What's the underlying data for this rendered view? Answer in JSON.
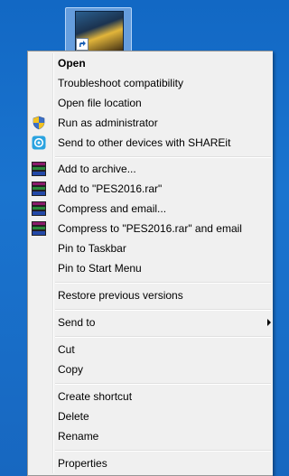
{
  "desktop": {
    "icon": {
      "name": "shortcut-icon",
      "thumbnail": "pes2016-game-cover"
    }
  },
  "context_menu": {
    "items": [
      {
        "label": "Open",
        "bold": true,
        "icon": null
      },
      {
        "label": "Troubleshoot compatibility",
        "icon": null
      },
      {
        "label": "Open file location",
        "icon": null
      },
      {
        "label": "Run as administrator",
        "icon": "uac-shield-icon"
      },
      {
        "label": "Send to other devices with SHAREit",
        "icon": "shareit-icon"
      },
      {
        "label": "Add to archive...",
        "icon": "winrar-icon"
      },
      {
        "label": "Add to \"PES2016.rar\"",
        "icon": "winrar-icon"
      },
      {
        "label": "Compress and email...",
        "icon": "winrar-icon"
      },
      {
        "label": "Compress to \"PES2016.rar\" and email",
        "icon": "winrar-icon"
      },
      {
        "label": "Pin to Taskbar",
        "icon": null
      },
      {
        "label": "Pin to Start Menu",
        "icon": null
      },
      {
        "label": "Restore previous versions",
        "icon": null
      },
      {
        "label": "Send to",
        "icon": null,
        "submenu": true
      },
      {
        "label": "Cut",
        "icon": null
      },
      {
        "label": "Copy",
        "icon": null
      },
      {
        "label": "Create shortcut",
        "icon": null
      },
      {
        "label": "Delete",
        "icon": null
      },
      {
        "label": "Rename",
        "icon": null
      },
      {
        "label": "Properties",
        "icon": null
      }
    ]
  },
  "colors": {
    "desktop_bg": "#1a74cf",
    "menu_bg": "#f0f0f0",
    "menu_border": "#979797",
    "shareit_blue": "#2aa3e0",
    "winrar_colors": [
      "#8b1a6b",
      "#2a8a3a",
      "#2348a8"
    ]
  }
}
